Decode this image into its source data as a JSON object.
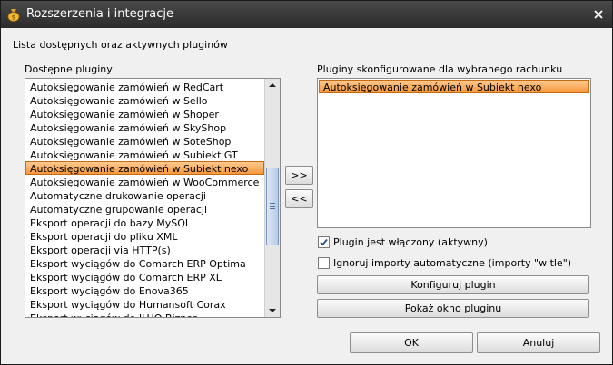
{
  "window": {
    "title": "Rozszerzenia i integracje"
  },
  "header_label": "Lista dostępnych oraz aktywnych pluginów",
  "available": {
    "label": "Dostępne pluginy",
    "items": [
      "Autoksięgowanie zamówień w RedCart",
      "Autoksięgowanie zamówień w Sello",
      "Autoksięgowanie zamówień w Shoper",
      "Autoksięgowanie zamówień w SkyShop",
      "Autoksięgowanie zamówień w SoteShop",
      "Autoksięgowanie zamówień w Subiekt GT",
      "Autoksięgowanie zamówień w Subiekt nexo",
      "Autoksięgowanie zamówień w WooCommerce",
      "Automatyczne drukowanie operacji",
      "Automatyczne grupowanie operacji",
      "Eksport operacji do bazy MySQL",
      "Eksport operacji do pliku XML",
      "Eksport operacji via HTTP(s)",
      "Eksport wyciągów do Comarch ERP Optima",
      "Eksport wyciągów do Comarch ERP XL",
      "Eksport wyciągów do Enova365",
      "Eksport wyciągów do Humansoft Corax",
      "Eksport wyciągów do ILUO Biznes"
    ],
    "selected_index": 6
  },
  "configured": {
    "label": "Pluginy skonfigurowane dla wybranego rachunku",
    "items": [
      "Autoksięgowanie zamówień w Subiekt nexo"
    ],
    "selected_index": 0
  },
  "buttons": {
    "add": ">>",
    "remove": "<<",
    "configure": "Konfiguruj plugin",
    "show_window": "Pokaż okno pluginu",
    "ok": "OK",
    "cancel": "Anuluj"
  },
  "options": {
    "enabled": {
      "label": "Plugin jest włączony (aktywny)",
      "checked": true
    },
    "ignore_imports": {
      "label": "Ignoruj importy automatyczne (importy \"w tle\")",
      "checked": false
    }
  },
  "icons": {
    "app": "money-bag-icon",
    "close": "close-icon",
    "scroll_up": "arrow-up-icon",
    "scroll_down": "arrow-down-icon"
  },
  "colors": {
    "selection": "#f6993c",
    "titlebar": "#2b2b2b"
  }
}
